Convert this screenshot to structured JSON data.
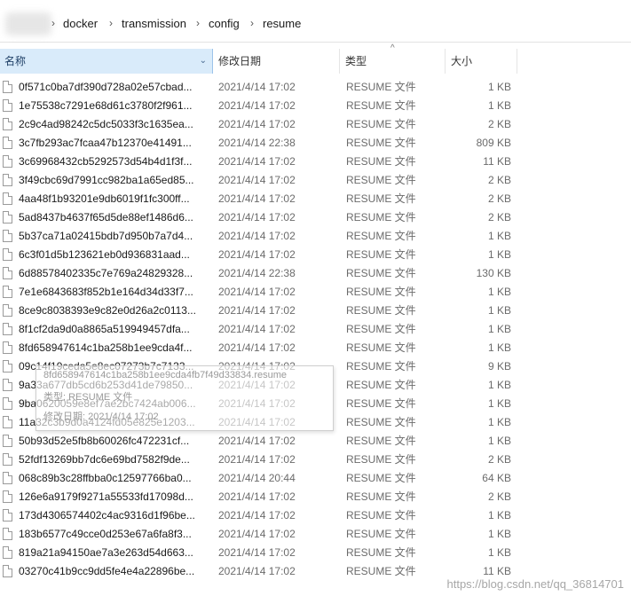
{
  "breadcrumb": [
    "docker",
    "transmission",
    "config",
    "resume"
  ],
  "columns": {
    "name": "名称",
    "date": "修改日期",
    "type": "类型",
    "size": "大小"
  },
  "files": [
    {
      "name": "0f571c0ba7df390d728a02e57cbad...",
      "date": "2021/4/14 17:02",
      "type": "RESUME 文件",
      "size": "1 KB"
    },
    {
      "name": "1e75538c7291e68d61c3780f2f961...",
      "date": "2021/4/14 17:02",
      "type": "RESUME 文件",
      "size": "1 KB"
    },
    {
      "name": "2c9c4ad98242c5dc5033f3c1635ea...",
      "date": "2021/4/14 17:02",
      "type": "RESUME 文件",
      "size": "2 KB"
    },
    {
      "name": "3c7fb293ac7fcaa47b12370e41491...",
      "date": "2021/4/14 22:38",
      "type": "RESUME 文件",
      "size": "809 KB"
    },
    {
      "name": "3c69968432cb5292573d54b4d1f3f...",
      "date": "2021/4/14 17:02",
      "type": "RESUME 文件",
      "size": "11 KB"
    },
    {
      "name": "3f49cbc69d7991cc982ba1a65ed85...",
      "date": "2021/4/14 17:02",
      "type": "RESUME 文件",
      "size": "2 KB"
    },
    {
      "name": "4aa48f1b93201e9db6019f1fc300ff...",
      "date": "2021/4/14 17:02",
      "type": "RESUME 文件",
      "size": "2 KB"
    },
    {
      "name": "5ad8437b4637f65d5de88ef1486d6...",
      "date": "2021/4/14 17:02",
      "type": "RESUME 文件",
      "size": "2 KB"
    },
    {
      "name": "5b37ca71a02415bdb7d950b7a7d4...",
      "date": "2021/4/14 17:02",
      "type": "RESUME 文件",
      "size": "1 KB"
    },
    {
      "name": "6c3f01d5b123621eb0d936831aad...",
      "date": "2021/4/14 17:02",
      "type": "RESUME 文件",
      "size": "1 KB"
    },
    {
      "name": "6d88578402335c7e769a24829328...",
      "date": "2021/4/14 22:38",
      "type": "RESUME 文件",
      "size": "130 KB"
    },
    {
      "name": "7e1e6843683f852b1e164d34d33f7...",
      "date": "2021/4/14 17:02",
      "type": "RESUME 文件",
      "size": "1 KB"
    },
    {
      "name": "8ce9c8038393e9c82e0d26a2c0113...",
      "date": "2021/4/14 17:02",
      "type": "RESUME 文件",
      "size": "1 KB"
    },
    {
      "name": "8f1cf2da9d0a8865a519949457dfa...",
      "date": "2021/4/14 17:02",
      "type": "RESUME 文件",
      "size": "1 KB"
    },
    {
      "name": "8fd658947614c1ba258b1ee9cda4f...",
      "date": "2021/4/14 17:02",
      "type": "RESUME 文件",
      "size": "1 KB"
    },
    {
      "name": "09c14f19ceda5e8ec07273b7c7133...",
      "date": "2021/4/14 17:02",
      "type": "RESUME 文件",
      "size": "9 KB"
    },
    {
      "name": "9a33a677db5cd6b253d41de79850...",
      "date": "2021/4/14 17:02",
      "type": "RESUME 文件",
      "size": "1 KB"
    },
    {
      "name": "9ba0620059e8ef7ae2bc7424ab006...",
      "date": "2021/4/14 17:02",
      "type": "RESUME 文件",
      "size": "1 KB"
    },
    {
      "name": "11a32c3b9d0a4124fd05e825e1203...",
      "date": "2021/4/14 17:02",
      "type": "RESUME 文件",
      "size": "1 KB"
    },
    {
      "name": "50b93d52e5fb8b60026fc472231cf...",
      "date": "2021/4/14 17:02",
      "type": "RESUME 文件",
      "size": "1 KB"
    },
    {
      "name": "52fdf13269bb7dc6e69bd7582f9de...",
      "date": "2021/4/14 17:02",
      "type": "RESUME 文件",
      "size": "2 KB"
    },
    {
      "name": "068c89b3c28ffbba0c12597766ba0...",
      "date": "2021/4/14 20:44",
      "type": "RESUME 文件",
      "size": "64 KB"
    },
    {
      "name": "126e6a9179f9271a55533fd17098d...",
      "date": "2021/4/14 17:02",
      "type": "RESUME 文件",
      "size": "2 KB"
    },
    {
      "name": "173d4306574402c4ac9316d1f96be...",
      "date": "2021/4/14 17:02",
      "type": "RESUME 文件",
      "size": "1 KB"
    },
    {
      "name": "183b6577c49cce0d253e67a6fa8f3...",
      "date": "2021/4/14 17:02",
      "type": "RESUME 文件",
      "size": "1 KB"
    },
    {
      "name": "819a21a94150ae7a3e263d54d663...",
      "date": "2021/4/14 17:02",
      "type": "RESUME 文件",
      "size": "1 KB"
    },
    {
      "name": "03270c41b9cc9dd5fe4e4a22896be...",
      "date": "2021/4/14 17:02",
      "type": "RESUME 文件",
      "size": "11 KB"
    }
  ],
  "tooltip": {
    "line1": "8fd658947614c1ba258b1ee9cda4fb7f49d33834.resume",
    "line2": "类型: RESUME 文件",
    "line3": "修改日期: 2021/4/14 17:02"
  },
  "watermark": "https://blog.csdn.net/qq_36814701"
}
